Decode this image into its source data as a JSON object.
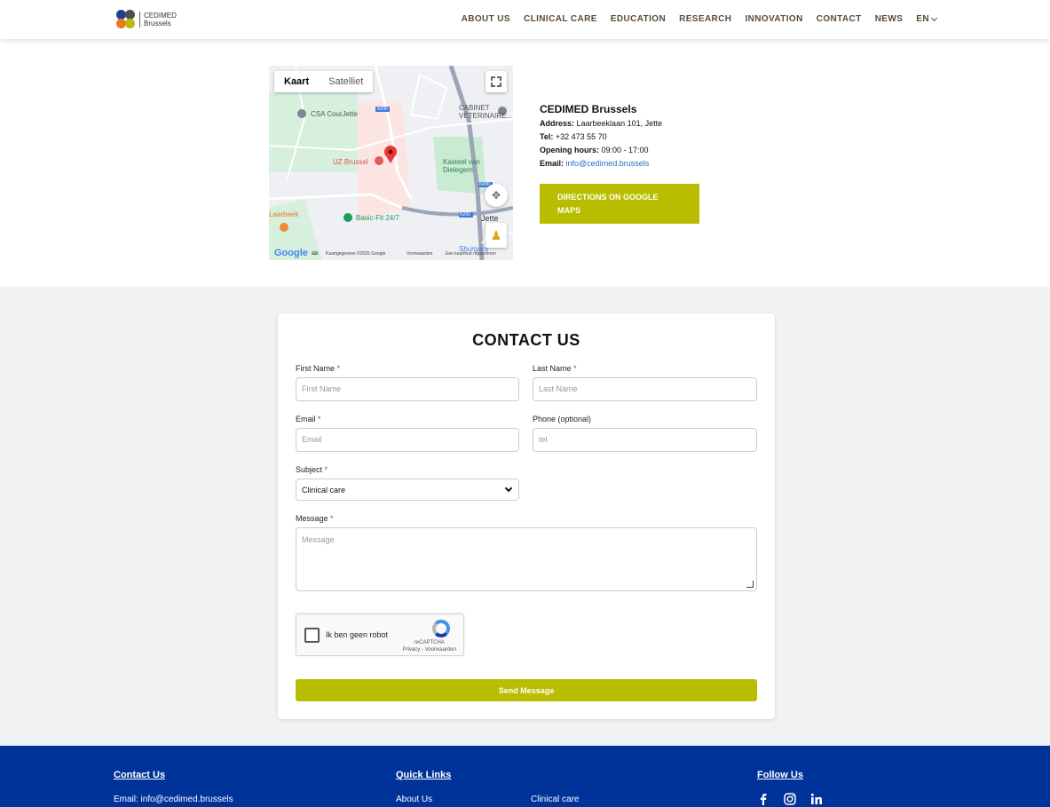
{
  "header": {
    "logo_line1": "CEDIMED",
    "logo_line2": "Brussels",
    "nav": [
      "ABOUT US",
      "CLINICAL CARE",
      "EDUCATION",
      "RESEARCH",
      "INNOVATION",
      "CONTACT",
      "NEWS"
    ],
    "lang": "EN"
  },
  "map": {
    "tab_map": "Kaart",
    "tab_satellite": "Satelliet",
    "labels": {
      "csa": "CSA CourJette",
      "cabinet": "CABINET VETERINAIRE...",
      "uz": "UZ Brussel",
      "kasteel": "Kasteel van Dielegem",
      "laarbeek": "Laarbeek",
      "basicfit": "Basic-Fit 24/7",
      "jette": "Jette",
      "shurgard": "Shurgard",
      "road1": "N290",
      "road2": "N290",
      "road3": "N290"
    },
    "footer": {
      "google": "Google",
      "keyboard": "Sneltoetsen",
      "terms_data": "Kaartgegevens ©2025 Google",
      "terms": "Voorwaarden",
      "report": "Een kaartfout rapporteren"
    }
  },
  "location": {
    "name": "CEDIMED Brussels",
    "address_label": "Address:",
    "address": "Laarbeeklaan 101, Jette",
    "tel_label": "Tel:",
    "tel": "+32 473 55 70",
    "hours_label": "Opening hours:",
    "hours": "09:00 - 17:00",
    "email_label": "Email:",
    "email": "info@cedimed.brussels",
    "directions_button": "DIRECTIONS ON GOOGLE MAPS"
  },
  "form": {
    "title": "CONTACT US",
    "first_name_label": "First Name",
    "first_name_placeholder": "First Name",
    "last_name_label": "Last Name",
    "last_name_placeholder": "Last Name",
    "email_label": "Email",
    "email_placeholder": "Email",
    "phone_label": "Phone (optional)",
    "phone_placeholder": "tel",
    "subject_label": "Subject",
    "subject_value": "Clinical care",
    "message_label": "Message",
    "message_placeholder": "Message",
    "required_mark": "*",
    "captcha_label": "Ik ben geen robot",
    "captcha_brand": "reCAPTCHA",
    "captcha_links": "Privacy - Voorwaarden",
    "send_button": "Send Message"
  },
  "footer": {
    "contact_title": "Contact Us",
    "contact_email": "Email: info@cedimed.brussels",
    "links_title": "Quick Links",
    "link1": "About Us",
    "link2": "Clinical care",
    "follow_title": "Follow Us",
    "social": [
      "facebook-icon",
      "instagram-icon",
      "linkedin-icon"
    ]
  },
  "colors": {
    "accent": "#b9bd00",
    "footer_bg": "#003399",
    "nav_text": "#5b4b3a",
    "link": "#2e6bc8"
  }
}
